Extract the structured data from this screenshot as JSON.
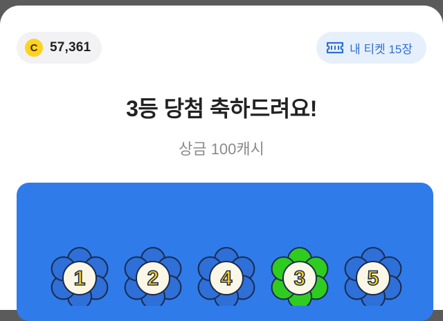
{
  "coin": {
    "icon": "coin-icon",
    "symbol": "C",
    "value": "57,361"
  },
  "ticket": {
    "icon": "ticket-icon",
    "label": "내 티켓 15장"
  },
  "result": {
    "title": "3등 당첨 축하드려요!",
    "prize": "상금 100캐시"
  },
  "flowers": [
    {
      "number": "1",
      "color": "#2e6fd8",
      "highlighted": false
    },
    {
      "number": "2",
      "color": "#2e6fd8",
      "highlighted": false
    },
    {
      "number": "4",
      "color": "#2e6fd8",
      "highlighted": false
    },
    {
      "number": "3",
      "color": "#2ecc1f",
      "highlighted": true
    },
    {
      "number": "5",
      "color": "#2e6fd8",
      "highlighted": false
    }
  ],
  "colors": {
    "board": "#2f7bea",
    "coin": "#ffd21f",
    "ticket_text": "#2f6fcf",
    "number_fill": "#ffd21f"
  }
}
